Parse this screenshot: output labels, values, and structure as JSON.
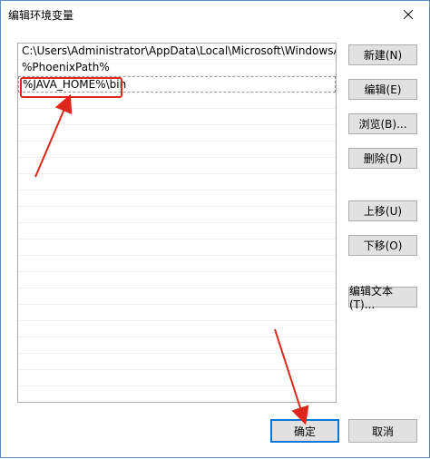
{
  "window": {
    "title": "编辑环境变量"
  },
  "list": {
    "items": [
      "C:\\Users\\Administrator\\AppData\\Local\\Microsoft\\WindowsApps",
      "%PhoenixPath%",
      "%JAVA_HOME%\\bin"
    ],
    "editing_index": 2
  },
  "buttons": {
    "new": "新建(N)",
    "edit": "编辑(E)",
    "browse": "浏览(B)...",
    "delete": "删除(D)",
    "move_up": "上移(U)",
    "move_down": "下移(O)",
    "edit_text": "编辑文本(T)..."
  },
  "footer": {
    "ok": "确定",
    "cancel": "取消"
  },
  "colors": {
    "accent": "#0078d7",
    "annotation": "#e0261c"
  },
  "icons": {
    "close": "close-icon"
  }
}
